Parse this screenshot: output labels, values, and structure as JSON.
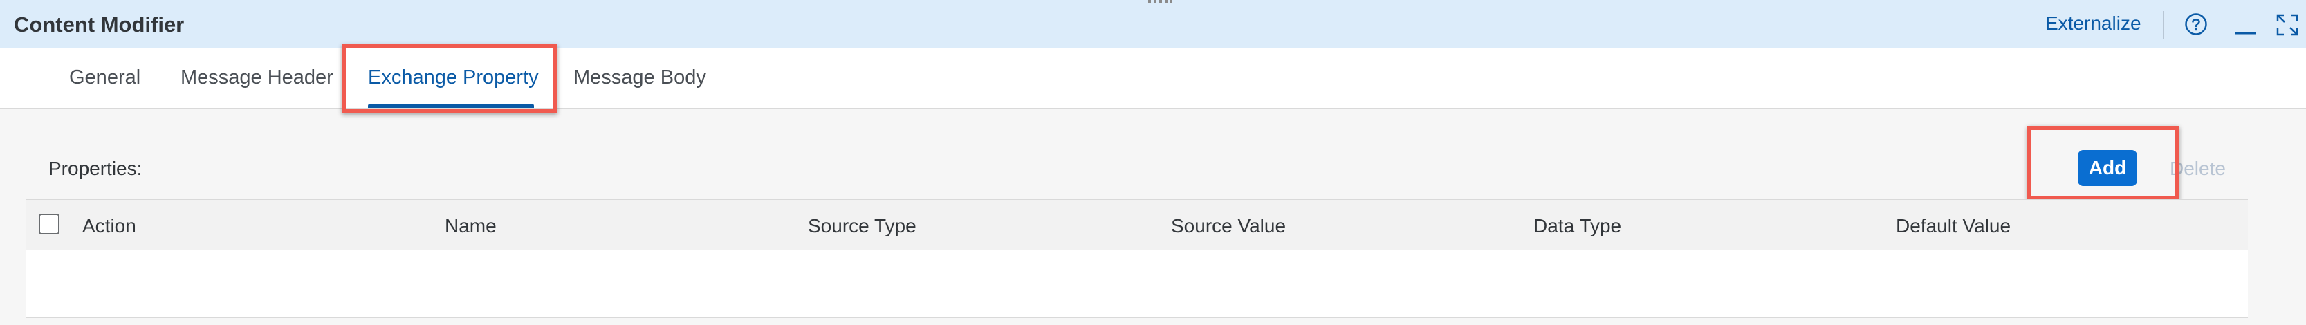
{
  "dialog": {
    "title": "Content Modifier",
    "externalize_label": "Externalize"
  },
  "tabs": [
    {
      "label": "General",
      "active": false
    },
    {
      "label": "Message Header",
      "active": false
    },
    {
      "label": "Exchange Property",
      "active": true
    },
    {
      "label": "Message Body",
      "active": false
    }
  ],
  "properties": {
    "label": "Properties:",
    "add_label": "Add",
    "delete_label": "Delete"
  },
  "table": {
    "columns": [
      "Action",
      "Name",
      "Source Type",
      "Source Value",
      "Data Type",
      "Default Value"
    ],
    "rows": []
  },
  "icons": {
    "help": "help-circle-icon",
    "minimize": "minimize-icon",
    "fullscreen": "fullscreen-icon"
  },
  "colors": {
    "accent": "#0a6ed1",
    "link": "#0a5aa6",
    "highlight": "#f05a4f",
    "titlebar": "#dcecfa"
  }
}
